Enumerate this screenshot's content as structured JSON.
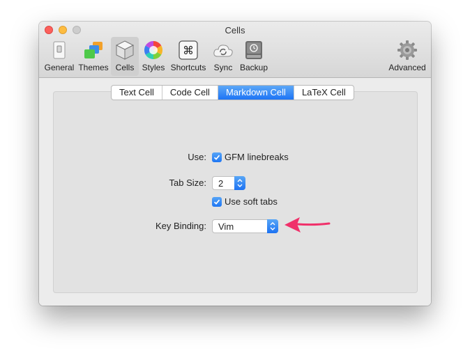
{
  "window": {
    "title": "Cells"
  },
  "toolbar": {
    "items": [
      {
        "label": "General",
        "icon": "general-switch-icon"
      },
      {
        "label": "Themes",
        "icon": "themes-windows-icon"
      },
      {
        "label": "Cells",
        "icon": "cells-cube-icon",
        "selected": true
      },
      {
        "label": "Styles",
        "icon": "styles-colorwheel-icon"
      },
      {
        "label": "Shortcuts",
        "icon": "command-key-icon"
      },
      {
        "label": "Sync",
        "icon": "sync-cloud-icon"
      },
      {
        "label": "Backup",
        "icon": "backup-drive-icon"
      },
      {
        "label": "Advanced",
        "icon": "advanced-gear-icon"
      }
    ]
  },
  "tabs": [
    {
      "label": "Text Cell"
    },
    {
      "label": "Code Cell"
    },
    {
      "label": "Markdown Cell",
      "active": true
    },
    {
      "label": "LaTeX Cell"
    }
  ],
  "form": {
    "use_label": "Use:",
    "gfm_label": "GFM linebreaks",
    "gfm_checked": true,
    "tab_size_label": "Tab Size:",
    "tab_size_value": "2",
    "soft_tabs_label": "Use soft tabs",
    "soft_tabs_checked": true,
    "key_binding_label": "Key Binding:",
    "key_binding_value": "Vim"
  },
  "colors": {
    "accent": "#1d74f5",
    "annotation_arrow": "#f0306a"
  }
}
